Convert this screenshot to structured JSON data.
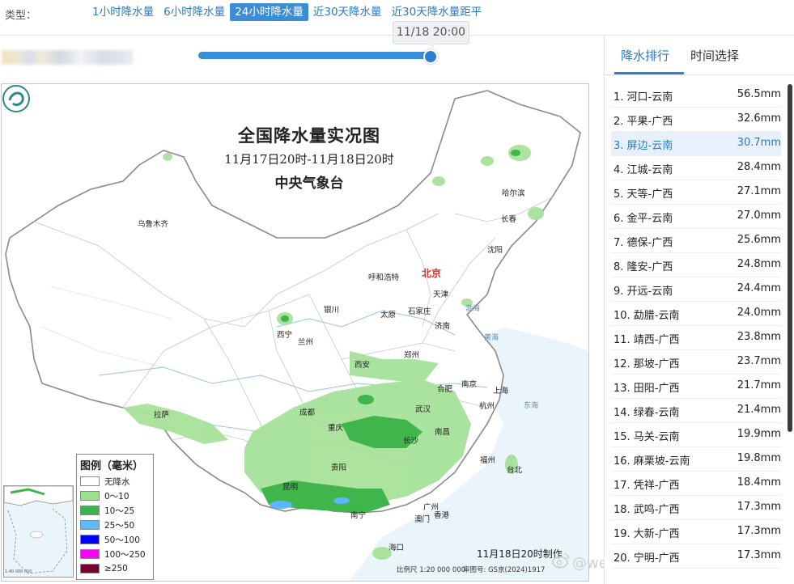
{
  "filter": {
    "label": "类型：",
    "tabs": [
      "1小时降水量",
      "6小时降水量",
      "24小时降水量",
      "近30天降水量",
      "近30天降水量距平"
    ],
    "active_index": 2
  },
  "timeline": {
    "tooltip": "11/18 20:00",
    "progress": 1.0
  },
  "map": {
    "title": "全国降水量实况图",
    "subtitle": "11月17日20时-11月18日20时",
    "agency": "中央气象台",
    "capital": "北京",
    "cities": [
      "乌鲁木齐",
      "哈尔滨",
      "长春",
      "沈阳",
      "呼和浩特",
      "天津",
      "石家庄",
      "银川",
      "太原",
      "济南",
      "西宁",
      "兰州",
      "西安",
      "郑州",
      "南京",
      "合肥",
      "上海",
      "拉萨",
      "成都",
      "重庆",
      "武汉",
      "杭州",
      "南昌",
      "长沙",
      "贵阳",
      "福州",
      "台北",
      "昆明",
      "南宁",
      "广州",
      "澳门",
      "香港",
      "海口"
    ],
    "seas": [
      "渤海",
      "黄海",
      "东海"
    ],
    "legend": {
      "title": "图例（毫米）",
      "items": [
        {
          "label": "无降水",
          "color": "#ffffff"
        },
        {
          "label": "0～10",
          "color": "#9be08a"
        },
        {
          "label": "10～25",
          "color": "#3bb44a"
        },
        {
          "label": "25～50",
          "color": "#62b8ff"
        },
        {
          "label": "50～100",
          "color": "#0000ff"
        },
        {
          "label": "100～250",
          "color": "#ff00ff"
        },
        {
          "label": "≥250",
          "color": "#7a0033"
        }
      ]
    },
    "made_time": "11月18日20时制作",
    "scale": "比例尺 1:20 000 000",
    "map_no": "审图号: GS京(2024)1917",
    "inset_scale": "1:40 000 000"
  },
  "watermark": "@weatherman_信欣",
  "side": {
    "tabs": [
      "降水排行",
      "时间选择"
    ],
    "active_tab": 0,
    "highlight_index": 2,
    "ranking": [
      {
        "name": "1. 河口-云南",
        "value": "56.5mm"
      },
      {
        "name": "2. 平果-广西",
        "value": "32.6mm"
      },
      {
        "name": "3. 屏边-云南",
        "value": "30.7mm"
      },
      {
        "name": "4. 江城-云南",
        "value": "28.4mm"
      },
      {
        "name": "5. 天等-广西",
        "value": "27.1mm"
      },
      {
        "name": "6. 金平-云南",
        "value": "27.0mm"
      },
      {
        "name": "7. 德保-广西",
        "value": "25.6mm"
      },
      {
        "name": "8. 隆安-广西",
        "value": "24.8mm"
      },
      {
        "name": "9. 开远-云南",
        "value": "24.4mm"
      },
      {
        "name": "10. 勐腊-云南",
        "value": "24.0mm"
      },
      {
        "name": "11. 靖西-广西",
        "value": "23.8mm"
      },
      {
        "name": "12. 那坡-广西",
        "value": "23.7mm"
      },
      {
        "name": "13. 田阳-广西",
        "value": "21.7mm"
      },
      {
        "name": "14. 绿春-云南",
        "value": "21.4mm"
      },
      {
        "name": "15. 马关-云南",
        "value": "19.9mm"
      },
      {
        "name": "16. 麻栗坡-云南",
        "value": "19.8mm"
      },
      {
        "name": "17. 凭祥-广西",
        "value": "18.4mm"
      },
      {
        "name": "18. 武鸣-广西",
        "value": "17.3mm"
      },
      {
        "name": "19. 大新-广西",
        "value": "17.3mm"
      },
      {
        "name": "20. 宁明-广西",
        "value": "17.3mm"
      }
    ]
  }
}
